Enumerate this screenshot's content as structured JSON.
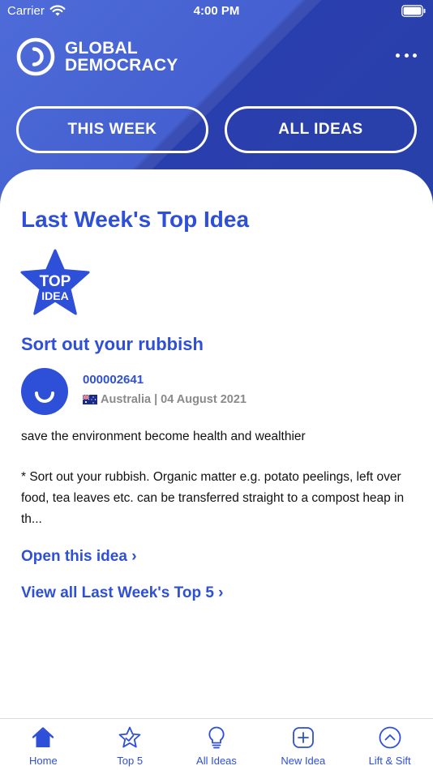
{
  "status_bar": {
    "carrier": "Carrier",
    "time": "4:00 PM"
  },
  "header": {
    "brand_line1": "GLOBAL",
    "brand_line2": "DEMOCRACY",
    "segments": [
      {
        "label": "THIS WEEK"
      },
      {
        "label": "ALL IDEAS"
      }
    ]
  },
  "main": {
    "section_title": "Last Week's Top Idea",
    "badge": {
      "line1": "TOP",
      "line2": "IDEA"
    },
    "idea": {
      "title": "Sort out your rubbish",
      "id": "000002641",
      "country": "Australia",
      "separator": "|",
      "date": "04 August 2021",
      "summary": "save the environment become health and wealthier",
      "body": "* Sort out your rubbish. Organic matter e.g. potato peelings, left over food, tea leaves etc. can be transferred straight to a compost heap in th..."
    },
    "links": {
      "open_idea": "Open this idea ›",
      "view_all": "View all Last Week's Top 5 ›"
    }
  },
  "tabbar": {
    "items": [
      {
        "label": "Home",
        "icon": "home-icon"
      },
      {
        "label": "Top 5",
        "icon": "star-check-icon"
      },
      {
        "label": "All Ideas",
        "icon": "lightbulb-icon"
      },
      {
        "label": "New Idea",
        "icon": "plus-square-icon"
      },
      {
        "label": "Lift & Sift",
        "icon": "chevron-up-circle-icon"
      }
    ]
  },
  "colors": {
    "brand_blue": "#2e4fd7",
    "header_blue": "#3553cc",
    "meta_gray": "#8a8a8a"
  }
}
